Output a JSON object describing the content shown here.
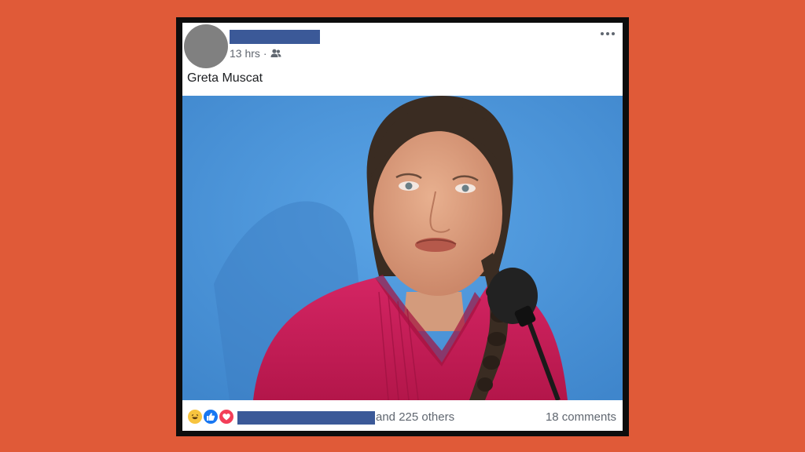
{
  "post": {
    "author_name": "",
    "timestamp": "13 hrs",
    "separator": "·",
    "audience_icon": "friends-icon",
    "text": "Greta Muscat",
    "menu_icon": "more-options-icon"
  },
  "footer": {
    "reactions": [
      "haha-icon",
      "like-icon",
      "love-icon"
    ],
    "others_text": "and 225 others",
    "comments_text": "18 comments"
  },
  "colors": {
    "background": "#e05a38",
    "redaction": "#3b5998",
    "photo_bg": "#4e94d6",
    "shirt": "#c2184f"
  }
}
